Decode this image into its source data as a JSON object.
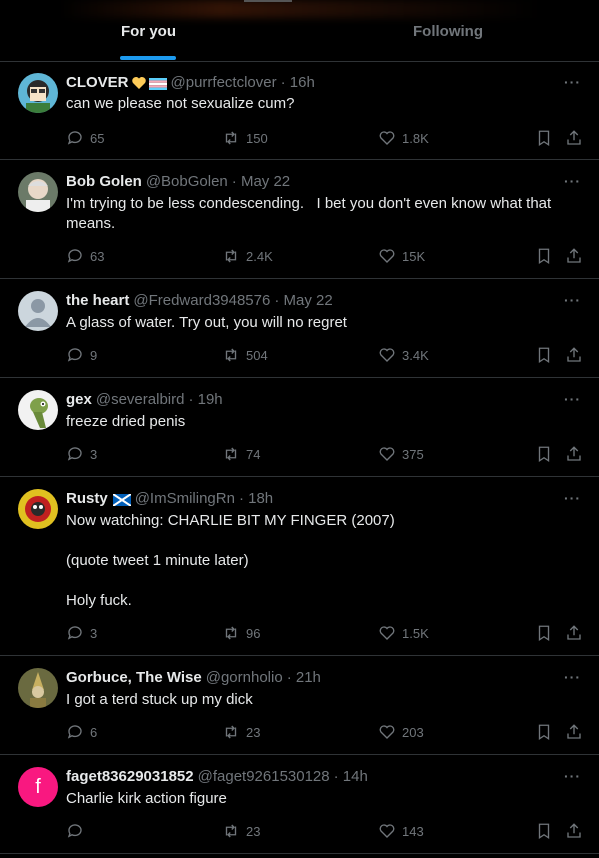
{
  "tabs": {
    "foryou": "For you",
    "following": "Following"
  },
  "more_label": "···",
  "tweets": [
    {
      "name": "CLOVER",
      "handle": "@purrfectclover",
      "time": "· 16h",
      "text": "can we please not sexualize cum?",
      "replies": "65",
      "retweets": "150",
      "likes": "1.8K"
    },
    {
      "name": "Bob Golen",
      "handle": "@BobGolen",
      "time": "· May 22",
      "text": "I'm trying to be less condescending.   I bet you don't even know what that means.",
      "replies": "63",
      "retweets": "2.4K",
      "likes": "15K"
    },
    {
      "name": "the heart",
      "handle": "@Fredward3948576",
      "time": "· May 22",
      "text": "A glass of water. Try out, you will no regret",
      "replies": "9",
      "retweets": "504",
      "likes": "3.4K"
    },
    {
      "name": "gex",
      "handle": "@severalbird",
      "time": "· 19h",
      "text": "freeze dried penis",
      "replies": "3",
      "retweets": "74",
      "likes": "375"
    },
    {
      "name": "Rusty",
      "handle": "@ImSmilingRn",
      "time": "· 18h",
      "text": "Now watching: CHARLIE BIT MY FINGER (2007)\n\n(quote tweet 1 minute later)\n\nHoly fuck.",
      "replies": "3",
      "retweets": "96",
      "likes": "1.5K"
    },
    {
      "name": "Gorbuce, The Wise",
      "handle": "@gornholio",
      "time": "· 21h",
      "text": "I got a terd stuck up my dick",
      "replies": "6",
      "retweets": "23",
      "likes": "203"
    },
    {
      "name": "faget83629031852",
      "handle": "@faget9261530128",
      "time": "· 14h",
      "text": "Charlie kirk action figure",
      "replies": "",
      "retweets": "23",
      "likes": "143",
      "avatar_letter": "f"
    }
  ],
  "colors": {
    "accent": "#1d9bf0",
    "text": "#e7e9ea",
    "muted": "#71767b",
    "border": "#2f3336",
    "letter_avatar": "#f91880"
  }
}
